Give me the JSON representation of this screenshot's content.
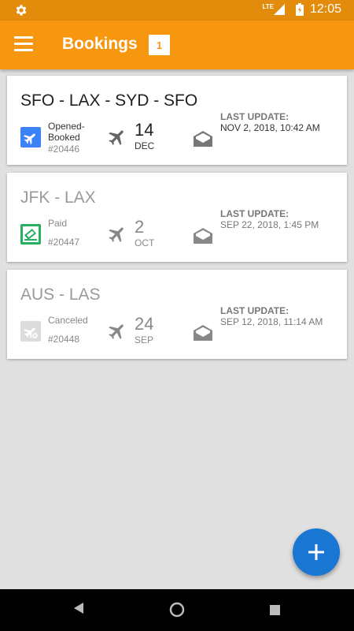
{
  "status_bar": {
    "time": "12:05",
    "network": "LTE"
  },
  "app_bar": {
    "title": "Bookings",
    "count": "1"
  },
  "bookings": [
    {
      "route": "SFO - LAX - SYD - SFO",
      "status": "Opened-Booked",
      "id": "#20446",
      "day": "14",
      "month": "DEC",
      "last_update_label": "LAST UPDATE:",
      "last_update": "NOV 2, 2018, 10:42 AM",
      "status_icon": "booked-plane-icon",
      "status_color": "#3b82f6"
    },
    {
      "route": "JFK - LAX",
      "status": "Paid",
      "id": "#20447",
      "day": "2",
      "month": "OCT",
      "last_update_label": "LAST UPDATE:",
      "last_update": "SEP 22, 2018, 1:45 PM",
      "status_icon": "paid-ticket-icon",
      "status_color": "#27ae60"
    },
    {
      "route": "AUS - LAS",
      "status": "Canceled",
      "id": "#20448",
      "day": "24",
      "month": "SEP",
      "last_update_label": "LAST UPDATE:",
      "last_update": "SEP 12, 2018, 11:14 AM",
      "status_icon": "canceled-plane-icon",
      "status_color": "#d6d6d6"
    }
  ],
  "colors": {
    "status_bar": "#e38b0a",
    "app_bar": "#f7960f",
    "fab": "#1976d2",
    "background": "#e0e0e0"
  }
}
